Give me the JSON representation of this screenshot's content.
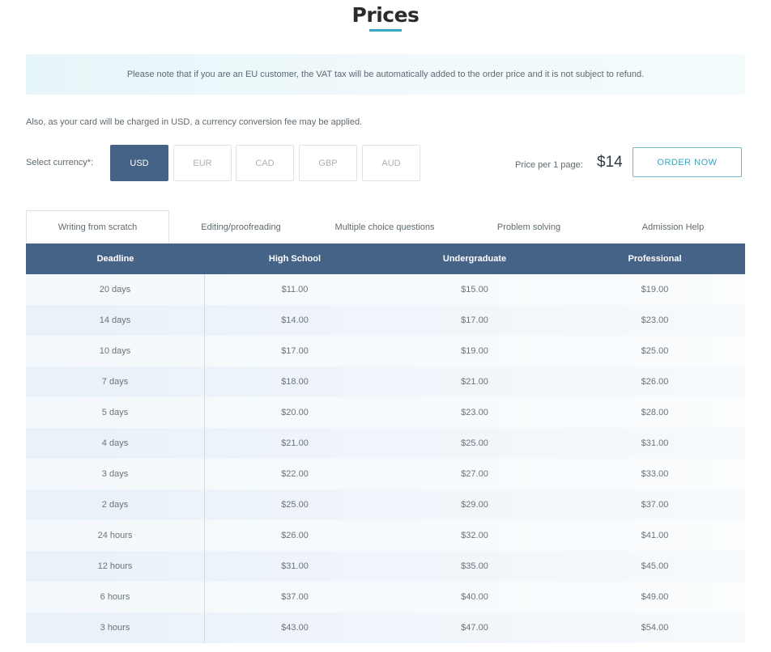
{
  "page": {
    "title": "Prices"
  },
  "notice": {
    "text": "Please note that if you are an EU customer, the VAT tax will be automatically added to the order price and it is not subject to refund."
  },
  "conversion_note": "Also, as your card will be charged in USD, a currency conversion fee may be applied.",
  "currency": {
    "label": "Select currency*:",
    "options": [
      "USD",
      "EUR",
      "CAD",
      "GBP",
      "AUD"
    ],
    "selected": "USD"
  },
  "price": {
    "label": "Price per 1 page:",
    "value": "$14"
  },
  "order_button": "ORDER NOW",
  "tabs": [
    {
      "label": "Writing from scratch",
      "active": true
    },
    {
      "label": "Editing/proofreading",
      "active": false
    },
    {
      "label": "Multiple choice questions",
      "active": false
    },
    {
      "label": "Problem solving",
      "active": false
    },
    {
      "label": "Admission Help",
      "active": false
    }
  ],
  "table": {
    "headers": [
      "Deadline",
      "High School",
      "Undergraduate",
      "Professional"
    ],
    "rows": [
      [
        "20 days",
        "$11.00",
        "$15.00",
        "$19.00"
      ],
      [
        "14 days",
        "$14.00",
        "$17.00",
        "$23.00"
      ],
      [
        "10 days",
        "$17.00",
        "$19.00",
        "$25.00"
      ],
      [
        "7 days",
        "$18.00",
        "$21.00",
        "$26.00"
      ],
      [
        "5 days",
        "$20.00",
        "$23.00",
        "$28.00"
      ],
      [
        "4 days",
        "$21.00",
        "$25.00",
        "$31.00"
      ],
      [
        "3 days",
        "$22.00",
        "$27.00",
        "$33.00"
      ],
      [
        "2 days",
        "$25.00",
        "$29.00",
        "$37.00"
      ],
      [
        "24 hours",
        "$26.00",
        "$32.00",
        "$41.00"
      ],
      [
        "12 hours",
        "$31.00",
        "$35.00",
        "$45.00"
      ],
      [
        "6 hours",
        "$37.00",
        "$40.00",
        "$49.00"
      ],
      [
        "3 hours",
        "$43.00",
        "$47.00",
        "$54.00"
      ]
    ]
  },
  "colors": {
    "primary": "#456387",
    "accent": "#3aa6c1",
    "notice_bg": "#e6f5f8"
  }
}
